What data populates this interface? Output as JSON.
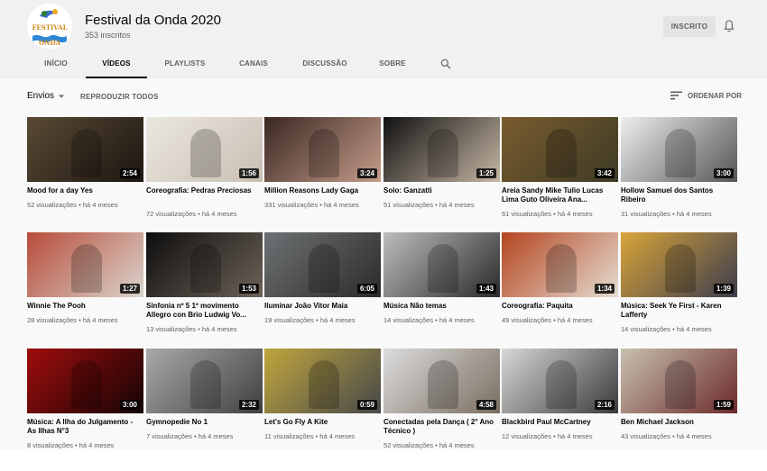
{
  "channel": {
    "name": "Festival da Onda 2020",
    "subscribers": "353 inscritos",
    "logo_text": "FESTIVAL DA ONDA",
    "subscribe_label": "INSCRITO"
  },
  "tabs": [
    {
      "label": "INÍCIO"
    },
    {
      "label": "VÍDEOS",
      "active": true
    },
    {
      "label": "PLAYLISTS"
    },
    {
      "label": "CANAIS"
    },
    {
      "label": "DISCUSSÃO"
    },
    {
      "label": "SOBRE"
    }
  ],
  "toolbar": {
    "uploads_label": "Envios",
    "play_all_label": "REPRODUZIR TODOS",
    "sort_label": "ORDENAR POR"
  },
  "videos": [
    {
      "title": "Mood for a day Yes",
      "meta": "52 visualizações • há 4 meses",
      "duration": "2:54",
      "colors": [
        "#5a4a35",
        "#1c1611"
      ]
    },
    {
      "title": "Coreografia: Pedras Preciosas",
      "meta": "72 visualizações • há 4 meses",
      "duration": "1:56",
      "colors": [
        "#ebe7e0",
        "#c9bfb3"
      ]
    },
    {
      "title": "Million Reasons Lady Gaga",
      "meta": "331 visualizações • há 4 meses",
      "duration": "3:24",
      "colors": [
        "#3a2822",
        "#c59c8a"
      ]
    },
    {
      "title": "Solo: Ganzatti",
      "meta": "51 visualizações • há 4 meses",
      "duration": "1:25",
      "colors": [
        "#111111",
        "#c7b7a5"
      ]
    },
    {
      "title": "Areia Sandy Mike Tulio Lucas Lima Guto Oliveira Ana...",
      "meta": "61 visualizações • há 4 meses",
      "duration": "3:42",
      "colors": [
        "#7a5c2e",
        "#3d3a25"
      ]
    },
    {
      "title": "Hollow Samuel dos Santos Ribeiro",
      "meta": "31 visualizações • há 4 meses",
      "duration": "3:00",
      "colors": [
        "#eeeeee",
        "#555555"
      ]
    },
    {
      "title": "Winnie The Pooh",
      "meta": "28 visualizações • há 4 meses",
      "duration": "1:27",
      "colors": [
        "#b84c3a",
        "#d9d4cc"
      ]
    },
    {
      "title": "Sinfonia nº 5 1º movimento Allegro con Brio Ludwig Vo...",
      "meta": "13 visualizações • há 4 meses",
      "duration": "1:53",
      "colors": [
        "#0e0e0e",
        "#6d6258"
      ]
    },
    {
      "title": "Iluminar João Vitor Maia",
      "meta": "19 visualizações • há 4 meses",
      "duration": "6:05",
      "colors": [
        "#6e7173",
        "#2b2b2b"
      ]
    },
    {
      "title": "Música Não temas",
      "meta": "14 visualizações • há 4 meses",
      "duration": "1:43",
      "colors": [
        "#bdbdbd",
        "#2a2a2a"
      ]
    },
    {
      "title": "Coreografia: Paquita",
      "meta": "49 visualizações • há 4 meses",
      "duration": "1:34",
      "colors": [
        "#b4451f",
        "#e5ddd2"
      ]
    },
    {
      "title": "Música: Seek Ye First - Karen Lafferty",
      "meta": "14 visualizações • há 4 meses",
      "duration": "1:39",
      "colors": [
        "#d9a53a",
        "#3c3c4c"
      ]
    },
    {
      "title": "Música:  A Ilha do Julgamento - As Ilhas N°3",
      "meta": "8 visualizações • há 4 meses",
      "duration": "3:00",
      "colors": [
        "#a00d0d",
        "#140404"
      ]
    },
    {
      "title": "Gymnopedie No 1",
      "meta": "7 visualizações • há 4 meses",
      "duration": "2:32",
      "colors": [
        "#aaaaaa",
        "#3f3f3f"
      ]
    },
    {
      "title": "Let's Go Fly A Kite",
      "meta": "11 visualizações • há 4 meses",
      "duration": "0:59",
      "colors": [
        "#c0a63c",
        "#46484a"
      ]
    },
    {
      "title": "Conectadas pela Dança ( 2° Ano Técnico )",
      "meta": "52 visualizações • há 4 meses",
      "duration": "4:58",
      "colors": [
        "#dcdcdc",
        "#7a6d60"
      ]
    },
    {
      "title": "Blackbird Paul McCartney",
      "meta": "12 visualizações • há 4 meses",
      "duration": "2:16",
      "colors": [
        "#d8d8d8",
        "#3a3a3a"
      ]
    },
    {
      "title": "Ben Michael Jackson",
      "meta": "43 visualizações • há 4 meses",
      "duration": "1:59",
      "colors": [
        "#c9c0b1",
        "#6b2a2a"
      ]
    }
  ],
  "icons": {
    "bell": "bell-icon",
    "search": "search-icon",
    "sort": "sort-icon",
    "caret": "caret-down-icon"
  },
  "colors": {
    "header_bg": "#f1f1f1",
    "page_bg": "#f9f9f9",
    "secondary_text": "#606060",
    "subscribed_bg": "#e4e4e4"
  }
}
